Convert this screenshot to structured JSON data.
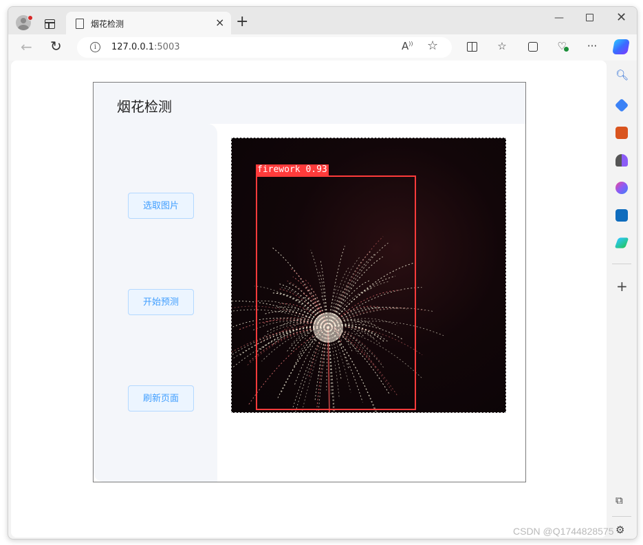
{
  "browser": {
    "tab_title": "烟花检测",
    "url_host": "127.0.0.1",
    "url_port": ":5003",
    "close_glyph": "×",
    "new_tab_glyph": "+",
    "minimize_glyph": "—",
    "close_window_glyph": "✕"
  },
  "app": {
    "title": "烟花检测",
    "buttons": {
      "select_image": "选取图片",
      "start_predict": "开始预测",
      "refresh_page": "刷新页面"
    },
    "detection": {
      "label": "firework 0.93",
      "class": "firework",
      "confidence": 0.93
    }
  },
  "watermark": "CSDN @Q1744828575",
  "colors": {
    "accent": "#409eff",
    "button_bg": "#ecf5ff",
    "button_border": "#b3d8ff",
    "detect_box": "#ff3b3b",
    "panel_bg": "#f4f6fa"
  }
}
